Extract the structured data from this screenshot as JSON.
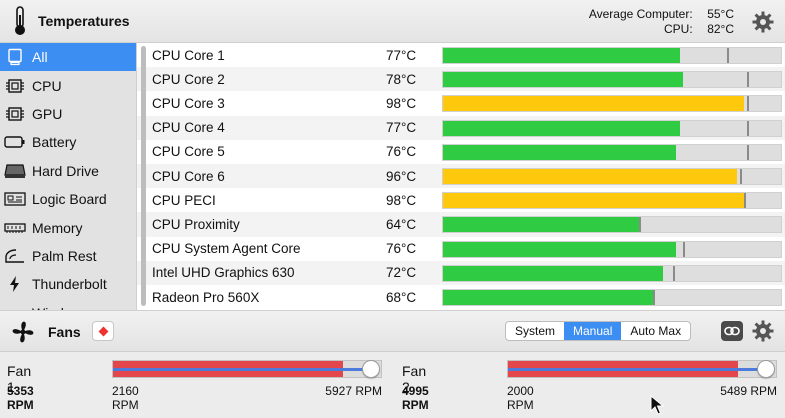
{
  "header": {
    "title": "Temperatures",
    "summary": [
      {
        "label": "Average Computer:",
        "value": "55°C"
      },
      {
        "label": "CPU:",
        "value": "82°C"
      }
    ]
  },
  "sidebar": {
    "items": [
      {
        "label": "All",
        "icon": "computer-icon",
        "active": true
      },
      {
        "label": "CPU",
        "icon": "chip-icon",
        "active": false
      },
      {
        "label": "GPU",
        "icon": "chip-icon",
        "active": false
      },
      {
        "label": "Battery",
        "icon": "battery-icon",
        "active": false
      },
      {
        "label": "Hard Drive",
        "icon": "hard-drive-icon",
        "active": false
      },
      {
        "label": "Logic Board",
        "icon": "logic-board-icon",
        "active": false
      },
      {
        "label": "Memory",
        "icon": "memory-icon",
        "active": false
      },
      {
        "label": "Palm Rest",
        "icon": "palm-rest-icon",
        "active": false
      },
      {
        "label": "Thunderbolt",
        "icon": "thunderbolt-icon",
        "active": false
      },
      {
        "label": "Wireless",
        "icon": "wireless-icon",
        "active": false
      }
    ]
  },
  "sensors": [
    {
      "name": "CPU Core 1",
      "temp": "77°C",
      "level": 0.7,
      "max": 0.84,
      "status": "ok"
    },
    {
      "name": "CPU Core 2",
      "temp": "78°C",
      "level": 0.71,
      "max": 0.9,
      "status": "ok"
    },
    {
      "name": "CPU Core 3",
      "temp": "98°C",
      "level": 0.89,
      "max": 0.9,
      "status": "hot"
    },
    {
      "name": "CPU Core 4",
      "temp": "77°C",
      "level": 0.7,
      "max": 0.9,
      "status": "ok"
    },
    {
      "name": "CPU Core 5",
      "temp": "76°C",
      "level": 0.69,
      "max": 0.9,
      "status": "ok"
    },
    {
      "name": "CPU Core 6",
      "temp": "96°C",
      "level": 0.87,
      "max": 0.88,
      "status": "hot"
    },
    {
      "name": "CPU PECI",
      "temp": "98°C",
      "level": 0.89,
      "max": 0.89,
      "status": "hot"
    },
    {
      "name": "CPU Proximity",
      "temp": "64°C",
      "level": 0.58,
      "max": 0.58,
      "status": "ok"
    },
    {
      "name": "CPU System Agent Core",
      "temp": "76°C",
      "level": 0.69,
      "max": 0.71,
      "status": "ok"
    },
    {
      "name": "Intel UHD Graphics 630",
      "temp": "72°C",
      "level": 0.65,
      "max": 0.68,
      "status": "ok"
    },
    {
      "name": "Radeon Pro 560X",
      "temp": "68°C",
      "level": 0.62,
      "max": 0.62,
      "status": "ok"
    }
  ],
  "fans_bar": {
    "title": "Fans",
    "modes": [
      {
        "label": "System",
        "selected": false
      },
      {
        "label": "Manual",
        "selected": true
      },
      {
        "label": "Auto Max",
        "selected": false
      }
    ]
  },
  "fans": [
    {
      "name": "Fan 1",
      "rpm": "5353 RPM",
      "min": "2160 RPM",
      "max": "5927 RPM",
      "level": 0.86
    },
    {
      "name": "Fan 2",
      "rpm": "4995 RPM",
      "min": "2000 RPM",
      "max": "5489 RPM",
      "level": 0.86
    }
  ],
  "colors": {
    "accent": "#3d8ef3",
    "ok": "#2ecb43",
    "hot": "#fec80c",
    "fan": "#e4474b"
  }
}
